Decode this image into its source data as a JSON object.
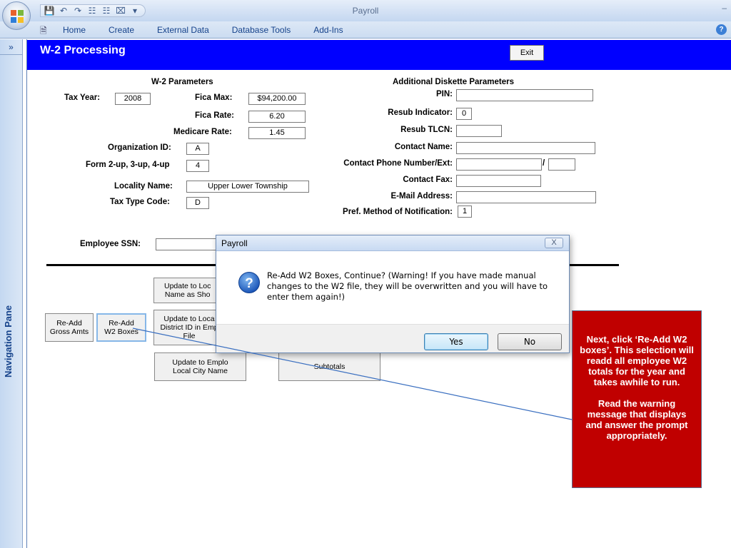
{
  "window": {
    "title": "Payroll",
    "minimize_glyph": "–"
  },
  "quick_access": {
    "icons": [
      "save-icon",
      "undo-icon",
      "redo-icon",
      "relationships-icon",
      "relationships-icon-2",
      "close-doc-icon",
      "customize-icon"
    ]
  },
  "ribbon": {
    "tabs": [
      "Home",
      "Create",
      "External Data",
      "Database Tools",
      "Add-Ins"
    ],
    "help_glyph": "?"
  },
  "nav_pane": {
    "label": "Navigation Pane",
    "toggle_glyph": "»"
  },
  "form": {
    "title": "W-2 Processing",
    "exit_label": "Exit",
    "w2_params_header": "W-2 Parameters",
    "add_params_header": "Additional Diskette Parameters",
    "tax_year_label": "Tax Year:",
    "tax_year_value": "2008",
    "fica_max_label": "Fica Max:",
    "fica_max_value": "$94,200.00",
    "fica_rate_label": "Fica Rate:",
    "fica_rate_value": "6.20",
    "medicare_rate_label": "Medicare Rate:",
    "medicare_rate_value": "1.45",
    "org_id_label": "Organization ID:",
    "org_id_value": "A",
    "form_up_label": "Form 2-up, 3-up, 4-up",
    "form_up_value": "4",
    "locality_label": "Locality Name:",
    "locality_value": "Upper Lower Township",
    "tax_type_label": "Tax Type Code:",
    "tax_type_value": "D",
    "pin_label": "PIN:",
    "pin_value": "",
    "resub_ind_label": "Resub Indicator:",
    "resub_ind_value": "0",
    "resub_tlcn_label": "Resub TLCN:",
    "resub_tlcn_value": "",
    "contact_name_label": "Contact Name:",
    "contact_name_value": "",
    "contact_phone_label": "Contact Phone Number/Ext:",
    "contact_phone_value": "",
    "contact_ext_value": "",
    "phone_sep": "/",
    "contact_fax_label": "Contact Fax:",
    "contact_fax_value": "",
    "email_label": "E-Mail Address:",
    "email_value": "",
    "pref_method_label": "Pref. Method of Notification:",
    "pref_method_value": "1",
    "employee_ssn_label": "Employee SSN:",
    "employee_ssn_value": "",
    "buttons": {
      "update_local_name": "Update to Loc\nName as Sho",
      "update_district": "Update to Loca\nDistrict ID in Emp\nFile",
      "update_city": "Update to Emplo\nLocal City Name",
      "readd_gross": "Re-Add\nGross Amts",
      "readd_w2": "Re-Add\nW2 Boxes",
      "subtotals": "Subtotals"
    }
  },
  "dialog": {
    "title": "Payroll",
    "close_glyph": "X",
    "message": "Re-Add W2 Boxes, Continue?  (Warning! If you have made manual changes to the W2 file, they will be overwritten and you will have to enter them again!)",
    "yes_label": "Yes",
    "no_label": "No",
    "icon": "question-icon"
  },
  "callout": {
    "paragraph1": "Next, click ‘Re-Add W2 boxes’. This selection will readd all employee W2 totals for the year and takes awhile to run.",
    "paragraph2": "Read the warning message that displays and answer the prompt appropriately.",
    "bg_color": "#c00000"
  },
  "colors": {
    "form_header": "#0000ff",
    "ribbon_text": "#15428b"
  }
}
